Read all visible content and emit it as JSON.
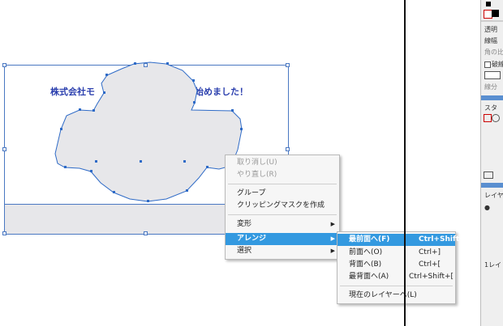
{
  "canvas": {
    "text_left": "株式会社モ",
    "text_right": "始めました！",
    "selection_color": "#4a78c2",
    "shape_fill": "#e7e7ea"
  },
  "context_menu": {
    "items": [
      {
        "label": "取り消し(U)",
        "disabled": true
      },
      {
        "label": "やり直し(R)",
        "disabled": true
      },
      {
        "label": "グループ"
      },
      {
        "label": "クリッピングマスクを作成"
      },
      {
        "label": "変形",
        "submenu": true
      },
      {
        "label": "アレンジ",
        "submenu": true,
        "active": true
      },
      {
        "label": "選択",
        "submenu": true
      }
    ]
  },
  "submenu": {
    "items": [
      {
        "label": "最前面へ(F)",
        "shortcut": "Ctrl+Shift+]",
        "active": true
      },
      {
        "label": "前面へ(O)",
        "shortcut": "Ctrl+]"
      },
      {
        "label": "背面へ(B)",
        "shortcut": "Ctrl+["
      },
      {
        "label": "最背面へ(A)",
        "shortcut": "Ctrl+Shift+["
      },
      {
        "label": "現在のレイヤーへ(L)"
      }
    ]
  },
  "panel": {
    "transparency_tab": "透明",
    "stroke_width_label": "線幅",
    "corner_label": "角の比",
    "dashed_label": "破線",
    "segment_label": "線分",
    "styles_tab": "スタ",
    "layers_tab": "レイヤ",
    "layer_count": "1レイ"
  },
  "colors": {
    "menu_highlight": "#3399e0",
    "panel_header": "#5a8fd0"
  }
}
